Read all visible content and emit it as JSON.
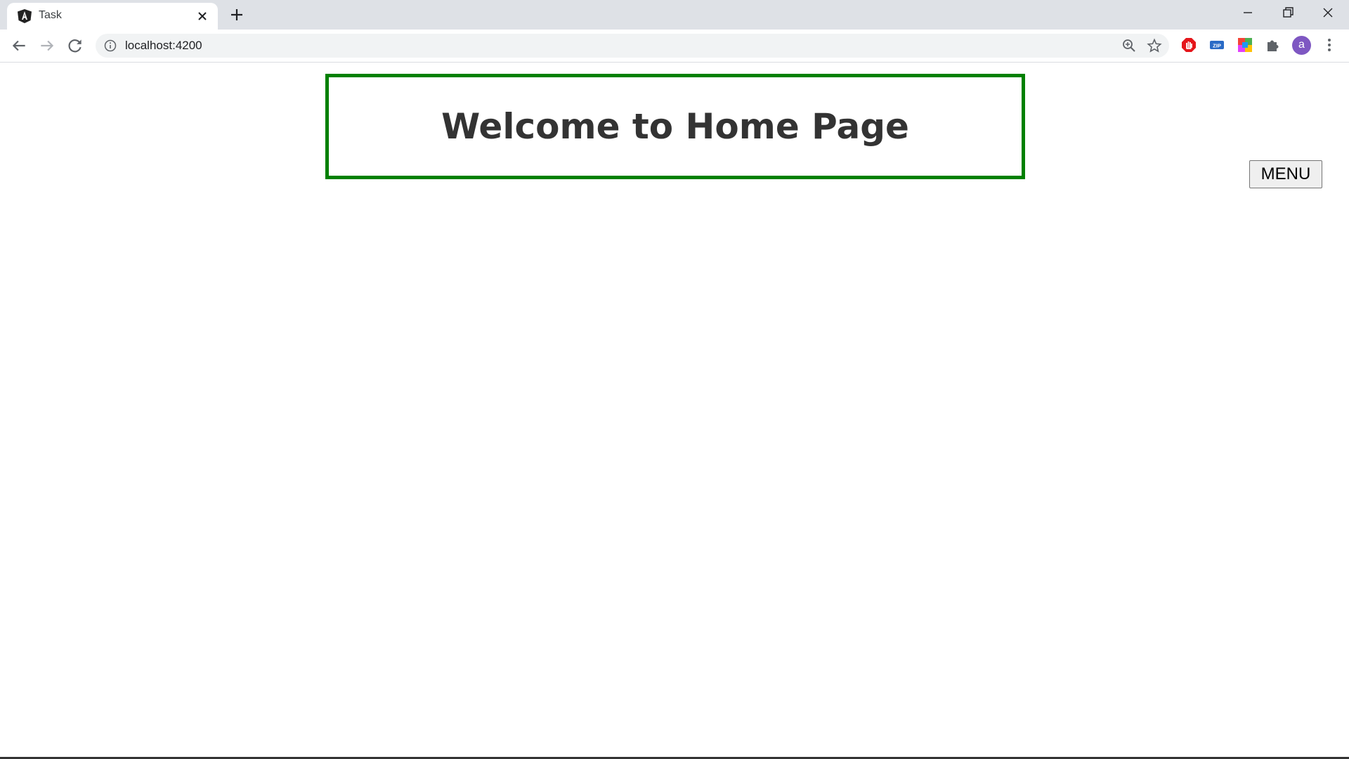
{
  "browser": {
    "tab": {
      "title": "Task",
      "favicon": "angular-icon"
    },
    "new_tab_icon": "plus-icon",
    "window_controls": [
      "minimize-icon",
      "restore-icon",
      "close-icon"
    ],
    "address_bar": {
      "url": "localhost:4200",
      "info_icon": "info-icon"
    },
    "toolbar_icons": [
      "back-arrow-icon",
      "forward-arrow-icon",
      "reload-icon",
      "zoom-icon",
      "star-icon"
    ],
    "extensions": [
      "adblock-icon",
      "zip-icon",
      "color-palette-icon",
      "puzzle-icon"
    ],
    "profile_initial": "a",
    "profile_color": "#7e57c2"
  },
  "page": {
    "heading": "Welcome to Home Page",
    "heading_border_color": "#008000",
    "menu_button_label": "MENU"
  }
}
